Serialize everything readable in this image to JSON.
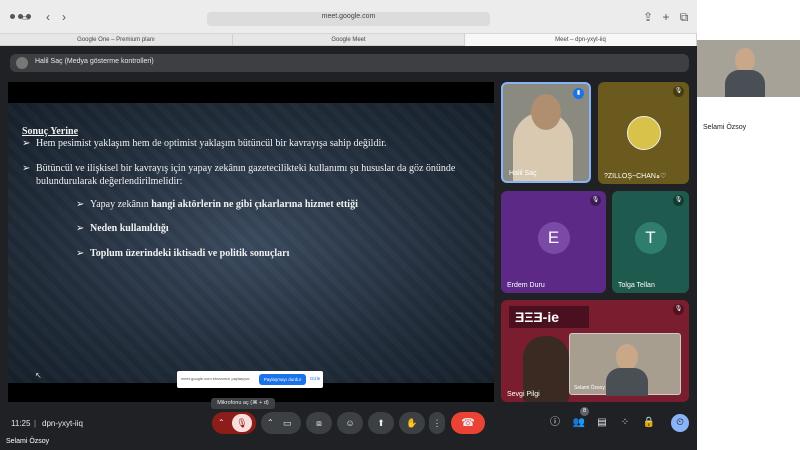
{
  "browser": {
    "address": "meet.google.com",
    "tabs": [
      {
        "label": "Google One – Premium planı"
      },
      {
        "label": "Google Meet"
      },
      {
        "label": "Meet – dpn-yxyt-iiq"
      }
    ]
  },
  "presenter_bar": {
    "label": "Halil Saç (Medya gösterme kontrolleri)"
  },
  "slide": {
    "heading": "Sonuç Yerine",
    "bullets": [
      "Hem pesimist yaklaşım hem de optimist yaklaşım bütüncül bir kavrayışa sahip değildir.",
      "Bütüncül ve ilişkisel bir kavrayış için yapay zekânın gazetecilikteki kullanımı şu hususlar da göz önünde bulundurularak değerlendirilmelidir:"
    ],
    "sub1_prefix": "Yapay zekânın ",
    "sub1_bold": "hangi aktörlerin ne gibi çıkarlarına hizmet ettiği",
    "sub2": "Neden kullanıldığı",
    "sub3": "Toplum üzerindeki iktisadi ve politik sonuçları"
  },
  "share_banner": {
    "text": "meet.google.com ekranınızı paylaşıyor.",
    "stop": "Paylaşmayı durdur",
    "hide": "Gizle"
  },
  "tooltip": {
    "text": "Mikrofonu aç (⌘ + d)"
  },
  "participants": {
    "halil": "Halil Saç",
    "zilloş": "?ZILLOŞ~CHANہ♡",
    "erdem": "Erdem Duru",
    "erdem_initial": "E",
    "tolga": "Tolga Tellan",
    "tolga_initial": "T",
    "sevgi": "Sevgi Pilgi",
    "selami_mini": "Selami Özsoy"
  },
  "bottom": {
    "time": "11:25",
    "separator": "|",
    "meeting_code": "dpn-yxyt-iiq",
    "participants_count": "8"
  },
  "side": {
    "name": "Selami Özsoy"
  },
  "footer": {
    "name": "Selami Özsoy"
  },
  "colors": {
    "end_call": "#ea4335",
    "erdem_tile": "#5c2a86",
    "tolga_tile": "#1e5a4e",
    "sevgi_tile": "#7a1d2e",
    "zillos_tile": "#6b5a1e"
  }
}
